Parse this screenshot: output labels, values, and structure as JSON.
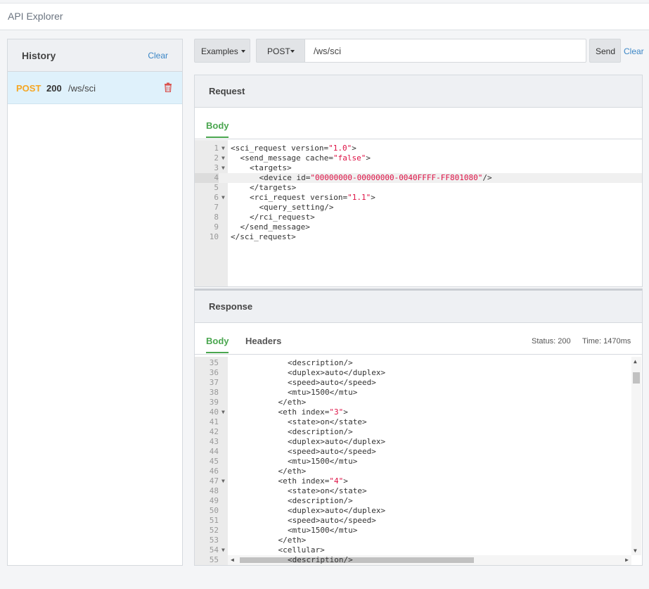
{
  "app": {
    "title": "API Explorer"
  },
  "history": {
    "title": "History",
    "clear_label": "Clear",
    "items": [
      {
        "method": "POST",
        "status": "200",
        "path": "/ws/sci"
      }
    ]
  },
  "toolbar": {
    "examples_label": "Examples",
    "method_label": "POST",
    "url_value": "/ws/sci",
    "send_label": "Send",
    "clear_label": "Clear"
  },
  "request": {
    "title": "Request",
    "tab_body": "Body",
    "lines": [
      {
        "n": "1",
        "fold": true,
        "indent": 0,
        "parts": [
          [
            "t",
            "<sci_request version="
          ],
          [
            "v",
            "\"1.0\""
          ],
          [
            "t",
            ">"
          ]
        ]
      },
      {
        "n": "2",
        "fold": true,
        "indent": 1,
        "parts": [
          [
            "t",
            "<send_message cache="
          ],
          [
            "v",
            "\"false\""
          ],
          [
            "t",
            ">"
          ]
        ]
      },
      {
        "n": "3",
        "fold": true,
        "indent": 2,
        "parts": [
          [
            "t",
            "<targets>"
          ]
        ]
      },
      {
        "n": "4",
        "fold": false,
        "indent": 3,
        "active": true,
        "parts": [
          [
            "t",
            "<device id="
          ],
          [
            "v",
            "\"00000000-00000000-0040FFFF-FF801080\""
          ],
          [
            "t",
            "/>"
          ]
        ]
      },
      {
        "n": "5",
        "fold": false,
        "indent": 2,
        "parts": [
          [
            "t",
            "</targets>"
          ]
        ]
      },
      {
        "n": "6",
        "fold": true,
        "indent": 2,
        "parts": [
          [
            "t",
            "<rci_request version="
          ],
          [
            "v",
            "\"1.1\""
          ],
          [
            "t",
            ">"
          ]
        ]
      },
      {
        "n": "7",
        "fold": false,
        "indent": 3,
        "parts": [
          [
            "t",
            "<query_setting/>"
          ]
        ]
      },
      {
        "n": "8",
        "fold": false,
        "indent": 2,
        "parts": [
          [
            "t",
            "</rci_request>"
          ]
        ]
      },
      {
        "n": "9",
        "fold": false,
        "indent": 1,
        "parts": [
          [
            "t",
            "</send_message>"
          ]
        ]
      },
      {
        "n": "10",
        "fold": false,
        "indent": 0,
        "parts": [
          [
            "t",
            "</sci_request>"
          ]
        ]
      }
    ]
  },
  "response": {
    "title": "Response",
    "tab_body": "Body",
    "tab_headers": "Headers",
    "status": "Status: 200",
    "time": "Time: 1470ms",
    "lines": [
      {
        "n": "35",
        "fold": false,
        "indent": 6,
        "parts": [
          [
            "t",
            "<description/>"
          ]
        ]
      },
      {
        "n": "36",
        "fold": false,
        "indent": 6,
        "parts": [
          [
            "t",
            "<duplex>auto</duplex>"
          ]
        ]
      },
      {
        "n": "37",
        "fold": false,
        "indent": 6,
        "parts": [
          [
            "t",
            "<speed>auto</speed>"
          ]
        ]
      },
      {
        "n": "38",
        "fold": false,
        "indent": 6,
        "parts": [
          [
            "t",
            "<mtu>1500</mtu>"
          ]
        ]
      },
      {
        "n": "39",
        "fold": false,
        "indent": 5,
        "parts": [
          [
            "t",
            "</eth>"
          ]
        ]
      },
      {
        "n": "40",
        "fold": true,
        "indent": 5,
        "parts": [
          [
            "t",
            "<eth index="
          ],
          [
            "v",
            "\"3\""
          ],
          [
            "t",
            ">"
          ]
        ]
      },
      {
        "n": "41",
        "fold": false,
        "indent": 6,
        "parts": [
          [
            "t",
            "<state>on</state>"
          ]
        ]
      },
      {
        "n": "42",
        "fold": false,
        "indent": 6,
        "parts": [
          [
            "t",
            "<description/>"
          ]
        ]
      },
      {
        "n": "43",
        "fold": false,
        "indent": 6,
        "parts": [
          [
            "t",
            "<duplex>auto</duplex>"
          ]
        ]
      },
      {
        "n": "44",
        "fold": false,
        "indent": 6,
        "parts": [
          [
            "t",
            "<speed>auto</speed>"
          ]
        ]
      },
      {
        "n": "45",
        "fold": false,
        "indent": 6,
        "parts": [
          [
            "t",
            "<mtu>1500</mtu>"
          ]
        ]
      },
      {
        "n": "46",
        "fold": false,
        "indent": 5,
        "parts": [
          [
            "t",
            "</eth>"
          ]
        ]
      },
      {
        "n": "47",
        "fold": true,
        "indent": 5,
        "parts": [
          [
            "t",
            "<eth index="
          ],
          [
            "v",
            "\"4\""
          ],
          [
            "t",
            ">"
          ]
        ]
      },
      {
        "n": "48",
        "fold": false,
        "indent": 6,
        "parts": [
          [
            "t",
            "<state>on</state>"
          ]
        ]
      },
      {
        "n": "49",
        "fold": false,
        "indent": 6,
        "parts": [
          [
            "t",
            "<description/>"
          ]
        ]
      },
      {
        "n": "50",
        "fold": false,
        "indent": 6,
        "parts": [
          [
            "t",
            "<duplex>auto</duplex>"
          ]
        ]
      },
      {
        "n": "51",
        "fold": false,
        "indent": 6,
        "parts": [
          [
            "t",
            "<speed>auto</speed>"
          ]
        ]
      },
      {
        "n": "52",
        "fold": false,
        "indent": 6,
        "parts": [
          [
            "t",
            "<mtu>1500</mtu>"
          ]
        ]
      },
      {
        "n": "53",
        "fold": false,
        "indent": 5,
        "parts": [
          [
            "t",
            "</eth>"
          ]
        ]
      },
      {
        "n": "54",
        "fold": true,
        "indent": 5,
        "parts": [
          [
            "t",
            "<cellular>"
          ]
        ]
      },
      {
        "n": "55",
        "fold": false,
        "indent": 6,
        "parts": [
          [
            "t",
            "<description/>"
          ]
        ]
      }
    ]
  },
  "colors": {
    "accent_green": "#4aa64f",
    "link_blue": "#3b86c6",
    "method_post": "#f5a623",
    "xml_value": "#d14"
  }
}
